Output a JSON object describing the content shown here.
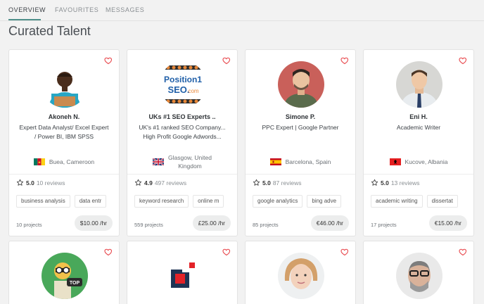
{
  "tabs": [
    {
      "label": "OVERVIEW",
      "active": true
    },
    {
      "label": "FAVOURITES",
      "active": false
    },
    {
      "label": "MESSAGES",
      "active": false
    }
  ],
  "heading": "Curated Talent",
  "colors": {
    "accent": "#4f8f8a",
    "heart": "#e8474c",
    "background": "#f2f2f2"
  },
  "cards": [
    {
      "name": "Akoneh N.",
      "title_line1": "Expert Data Analyst/ Excel Expert",
      "title_line2": "/ Power BI, IBM SPSS",
      "location_line1": "Buea, Cameroon",
      "location_line2": "",
      "flag": "cameroon-flag-icon",
      "rating": "5.0",
      "reviews": "10 reviews",
      "tags": [
        "business analysis",
        "data entr"
      ],
      "projects": "10 projects",
      "price": "$10.00 /hr"
    },
    {
      "name": "UKs #1 SEO Experts ..",
      "title_line1": "UK's #1 ranked SEO Company...",
      "title_line2": "High Profit Google Adwords...",
      "location_line1": "Glasgow, United",
      "location_line2": "Kingdom",
      "flag": "uk-flag-icon",
      "rating": "4.9",
      "reviews": "497 reviews",
      "tags": [
        "keyword research",
        "online m"
      ],
      "projects": "559 projects",
      "price": "£25.00 /hr",
      "logo_text": "Position1",
      "logo_text2": "SEO.",
      "logo_text3": "com"
    },
    {
      "name": "Simone P.",
      "title_line1": "PPC Expert | Google Partner",
      "title_line2": "",
      "location_line1": "Barcelona, Spain",
      "location_line2": "",
      "flag": "spain-flag-icon",
      "rating": "5.0",
      "reviews": "87 reviews",
      "tags": [
        "google analytics",
        "bing adve"
      ],
      "projects": "85 projects",
      "price": "€46.00 /hr"
    },
    {
      "name": "Eni H.",
      "title_line1": "Academic Writer",
      "title_line2": "",
      "location_line1": "Kucove, Albania",
      "location_line2": "",
      "flag": "albania-flag-icon",
      "rating": "5.0",
      "reviews": "13 reviews",
      "tags": [
        "academic writing",
        "dissertat"
      ],
      "projects": "17 projects",
      "price": "€15.00 /hr"
    }
  ],
  "row2_badge": "TOP"
}
